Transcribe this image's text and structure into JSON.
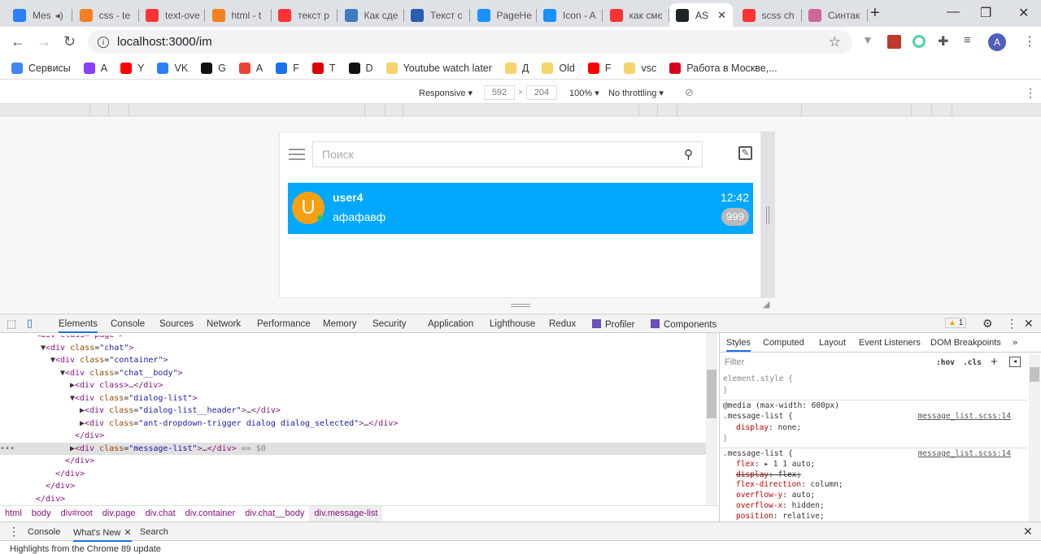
{
  "browser": {
    "tabs": [
      {
        "label": "Mes",
        "icon": "messenger-icon",
        "color": "#2d7ff9",
        "audio": true
      },
      {
        "label": "css - te",
        "icon": "stackoverflow-icon",
        "color": "#f48024"
      },
      {
        "label": "text-ove",
        "icon": "yandex-icon",
        "color": "#f33"
      },
      {
        "label": "html - t",
        "icon": "stackoverflow-icon",
        "color": "#f48024"
      },
      {
        "label": "текст р",
        "icon": "yandex-icon",
        "color": "#f33"
      },
      {
        "label": "Как сде",
        "icon": "w-icon",
        "color": "#3e7bc0"
      },
      {
        "label": "Текст с",
        "icon": "qr-icon",
        "color": "#2a5db0"
      },
      {
        "label": "PageHe",
        "icon": "antd-icon",
        "color": "#1890ff"
      },
      {
        "label": "Icon - A",
        "icon": "antd-icon",
        "color": "#1890ff"
      },
      {
        "label": "как смє",
        "icon": "yandex-icon",
        "color": "#f33"
      },
      {
        "label": "AS",
        "icon": "react-icon",
        "color": "#20232a",
        "active": true
      },
      {
        "label": "scss ch",
        "icon": "yandex-icon",
        "color": "#f33"
      },
      {
        "label": "Синтак",
        "icon": "sass-icon",
        "color": "#cd6799"
      }
    ],
    "new_tab": "+",
    "url": "localhost:3000/im",
    "profile_initial": "A",
    "bookmarks": [
      {
        "label": "Сервисы",
        "color": "#4285f4"
      },
      {
        "label": "A",
        "color": "#8a3ffc"
      },
      {
        "label": "Y",
        "color": "#f00"
      },
      {
        "label": "VK",
        "color": "#2d7ff9"
      },
      {
        "label": "G",
        "color": "#111"
      },
      {
        "label": "A",
        "color": "#ea4335"
      },
      {
        "label": "F",
        "color": "#1a73e8"
      },
      {
        "label": "T",
        "color": "#d00"
      },
      {
        "label": "D",
        "color": "#111"
      },
      {
        "label": "Youtube watch later",
        "color": "#f6d36b"
      },
      {
        "label": "Д",
        "color": "#f6d36b"
      },
      {
        "label": "Old",
        "color": "#f6d36b"
      },
      {
        "label": "F",
        "color": "#f00"
      },
      {
        "label": "vsc",
        "color": "#f6d36b"
      },
      {
        "label": "Работа в Москве,...",
        "color": "#d6001c"
      }
    ]
  },
  "device_toolbar": {
    "device": "Responsive",
    "width": "592",
    "height": "204",
    "zoom": "100%",
    "throttling": "No throttling"
  },
  "app": {
    "search_placeholder": "Поиск",
    "dialog": {
      "avatar_letter": "U",
      "name": "user4",
      "message": "афафавф",
      "time": "12:42",
      "unread": "999",
      "accent": "#00a8ff",
      "avatar_color": "#f5a011",
      "online": true
    }
  },
  "devtools": {
    "tabs": [
      "Elements",
      "Console",
      "Sources",
      "Network",
      "Performance",
      "Memory",
      "Security",
      "Application",
      "Lighthouse",
      "Redux",
      "Profiler",
      "Components"
    ],
    "active_tab": "Elements",
    "warnings": "1",
    "dom_lines": [
      {
        "indent": 5,
        "text": "<div class=\"page\">",
        "cut": true
      },
      {
        "indent": 6,
        "open": true,
        "tag": "div",
        "cls": "chat"
      },
      {
        "indent": 7,
        "open": true,
        "tag": "div",
        "cls": "container"
      },
      {
        "indent": 8,
        "open": true,
        "tag": "div",
        "cls": "chat__body"
      },
      {
        "indent": 9,
        "closed": true,
        "raw": "<div class>…</div>"
      },
      {
        "indent": 9,
        "open": true,
        "tag": "div",
        "cls": "dialog-list"
      },
      {
        "indent": 10,
        "closed": true,
        "tag": "div",
        "cls": "dialog-list__header",
        "collapsed": true
      },
      {
        "indent": 10,
        "closed": true,
        "tag": "div",
        "cls": "ant-dropdown-trigger dialog dialog_selected",
        "collapsed": true
      },
      {
        "indent": 9,
        "raw": "</div>"
      },
      {
        "indent": 9,
        "closed": true,
        "tag": "div",
        "cls": "message-list",
        "collapsed": true,
        "selected": true,
        "suffix": " == $0"
      },
      {
        "indent": 8,
        "raw": "</div>"
      },
      {
        "indent": 7,
        "raw": "</div>"
      },
      {
        "indent": 6,
        "raw": "</div>"
      },
      {
        "indent": 5,
        "raw": "</div>"
      }
    ],
    "breadcrumbs": [
      "html",
      "body",
      "div#root",
      "div.page",
      "div.chat",
      "div.container",
      "div.chat__body",
      "div.message-list"
    ],
    "styles_tabs": [
      "Styles",
      "Computed",
      "Layout",
      "Event Listeners",
      "DOM Breakpoints",
      "»"
    ],
    "filter_placeholder": "Filter",
    "hov": ":hov",
    "cls": ".cls",
    "rules": {
      "element_style": "element.style {",
      "media": "@media (max-width: 600px)",
      "selector": ".message-list {",
      "source": "message_list.scss:14",
      "rule1_props": [
        {
          "p": "display",
          "v": "none;"
        }
      ],
      "rule2_props": [
        {
          "p": "flex",
          "v": "▸ 1 1 auto;"
        },
        {
          "p": "display",
          "v": "flex;",
          "struck": true
        },
        {
          "p": "flex-direction",
          "v": "column;"
        },
        {
          "p": "overflow-y",
          "v": "auto;"
        },
        {
          "p": "overflow-x",
          "v": "hidden;"
        },
        {
          "p": "position",
          "v": "relative;"
        }
      ],
      "close": "}"
    },
    "drawer_tabs": [
      "Console",
      "What's New",
      "Search"
    ],
    "drawer_active": "What's New",
    "drawer_text": "Highlights from the Chrome 89 update"
  }
}
